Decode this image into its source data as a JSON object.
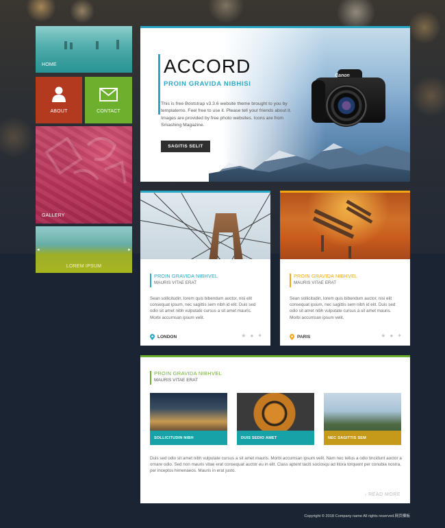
{
  "sidebar": {
    "home": "HOME",
    "about": "ABOUT",
    "contact": "CONTACT",
    "gallery": "GALLERY",
    "lorem": "LOREM IPSUM"
  },
  "hero": {
    "title": "ACCORD",
    "subtitle": "PROIN GRAVIDA NIBHISI",
    "description": "This is free Bootstrap v3.3.6 website theme brought to you by templatemo. Feel free to use it. Please tell your friends about it. Images are provided by free photo websites. Icons are from Smashing Magazine.",
    "button": "SAGITIS SELIT",
    "camera_brand": "Canon"
  },
  "cards": [
    {
      "title": "PROIN GRAVIDA NIBHVEL",
      "subtitle": "MAURIS VITAE ERAT",
      "text": "Sean sollicitudin, lorem quis bibendum auctor, nisi elit consequat ipsum, nec sagittis sem nibh id elit. Duis sed odio sit amet nibh vulputate cursus a sit amet mauris. Morbi accumsan ipsum velit.",
      "location": "LONDON",
      "accent": "#29a8c6"
    },
    {
      "title": "PROIN GRAVIDA NIBHVEL",
      "subtitle": "MAURIS VITAE ERAT",
      "text": "Sean sollicitudin, lorem quis bibendum auctor, nisi elit consequat ipsum, nec sagittis sem nibh id elit. Duis sed odio sit amet nibh vulputate cursus a sit amet mauris. Morbi accumsan ipsum velit.",
      "location": "PARIS",
      "accent": "#f2a614"
    }
  ],
  "panel": {
    "title": "PROIN GRAVIDA NIBHVEL",
    "subtitle": "MAURIS VITAE ERAT",
    "thumbs": [
      {
        "caption": "SOLLICITUDIN NIBH"
      },
      {
        "caption": "DUIS SEDIO AMET"
      },
      {
        "caption": "NEC SAGITTIS SEM"
      }
    ],
    "text": "Duis sed odio sit amet nibh vulputate cursus a sit amet mauris. Morbi accumsan ipsum velit. Nam nec tellus a odio tincidunt auctor a ornare odio. Sed non mauris vitae erat consequat auctor eu in elit. Class aptent taciti sociosqu ad litora torquent per conubia nostra, per inceptos himenaeos. Mauris in erat justo.",
    "more": "› READ MORE",
    "accent": "#6cb02e"
  },
  "footer": "Copyright © 2018 Company name All rights reserved.网页模板",
  "icons": {
    "about": "user-icon",
    "contact": "envelope-icon",
    "location": "map-pin-icon",
    "star": "star-icon",
    "user": "user-icon",
    "twitter": "twitter-icon"
  }
}
